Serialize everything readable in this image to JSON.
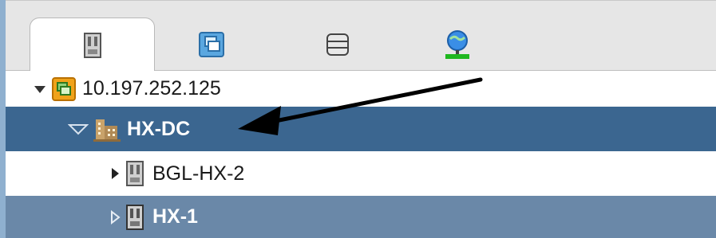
{
  "tabs": [
    {
      "icon": "host-icon",
      "selected": true
    },
    {
      "icon": "vm-icon",
      "selected": false
    },
    {
      "icon": "datastore-icon",
      "selected": false
    },
    {
      "icon": "network-icon",
      "selected": false
    }
  ],
  "tree": [
    {
      "label": "10.197.252.125",
      "icon": "vcenter-icon",
      "expanded": true,
      "selected": false
    },
    {
      "label": "HX-DC",
      "icon": "datacenter-icon",
      "expanded": true,
      "selected": true
    },
    {
      "label": "BGL-HX-2",
      "icon": "host-icon",
      "expanded": false,
      "selected": false
    },
    {
      "label": "HX-1",
      "icon": "host-icon",
      "expanded": false,
      "selected": false,
      "highlighted": true
    }
  ],
  "annotation": {
    "type": "arrow",
    "color": "#000000",
    "target": "HX-DC"
  },
  "colors": {
    "selected_row": "#3b6690",
    "highlight_row": "#6a88a8",
    "toolbar_bg": "#e6e6e6",
    "accent_green": "#1fb81f",
    "accent_orange": "#f0a21a"
  }
}
